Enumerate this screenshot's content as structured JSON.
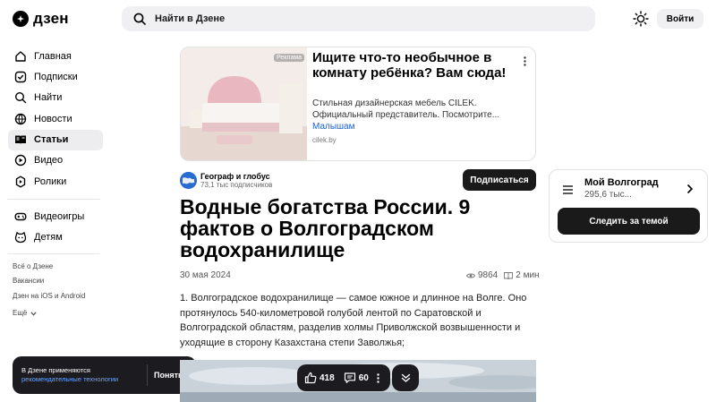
{
  "header": {
    "logo_text": "дзен",
    "search_placeholder": "Найти в Дзене",
    "login_label": "Войти"
  },
  "sidebar": {
    "items": [
      {
        "label": "Главная",
        "icon": "home-icon"
      },
      {
        "label": "Подписки",
        "icon": "subscriptions-icon"
      },
      {
        "label": "Найти",
        "icon": "search-icon"
      },
      {
        "label": "Новости",
        "icon": "news-icon"
      },
      {
        "label": "Статьи",
        "icon": "articles-icon",
        "active": true
      },
      {
        "label": "Видео",
        "icon": "video-icon"
      },
      {
        "label": "Ролики",
        "icon": "shorts-icon"
      },
      {
        "label": "Видеоигры",
        "icon": "gamepad-icon"
      },
      {
        "label": "Детям",
        "icon": "kids-icon"
      }
    ],
    "footer_links": [
      "Всё о Дзене",
      "Вакансии",
      "Дзен на iOS и Android"
    ],
    "more_label": "Ещё"
  },
  "cookie": {
    "text": "В Дзене применяются",
    "link": "рекомендательные технологии",
    "button": "Понятно"
  },
  "ad": {
    "label": "Реклама",
    "title": "Ищите что-то необычное в комнату ребёнка? Вам сюда!",
    "description": "Стильная дизайнерская мебель CILEK. Официальный представитель. Посмотрите...",
    "link": "Малышам",
    "domain": "cilek.by"
  },
  "author": {
    "name": "Географ и глобус",
    "subscribers": "73,1 тыс подписчиков",
    "subscribe_label": "Подписаться"
  },
  "article": {
    "title": "Водные богатства России. 9 фактов о Волгоградском водохранилище",
    "date": "30 мая 2024",
    "views": "9864",
    "read_time": "2 мин",
    "body": "1. Волгоградское водохранилище — самое южное и длинное на Волге. Оно протянулось 540-километровой голубой лентой по Саратовской и Волгоградской областям, разделив холмы Приволжской возвышенности и уходящие в сторону Казахстана степи Заволжья;"
  },
  "actions": {
    "likes": "418",
    "comments": "60"
  },
  "topic": {
    "name": "Мой Волгоград",
    "count": "295,6 тыс...",
    "follow_label": "Следить за темой"
  }
}
